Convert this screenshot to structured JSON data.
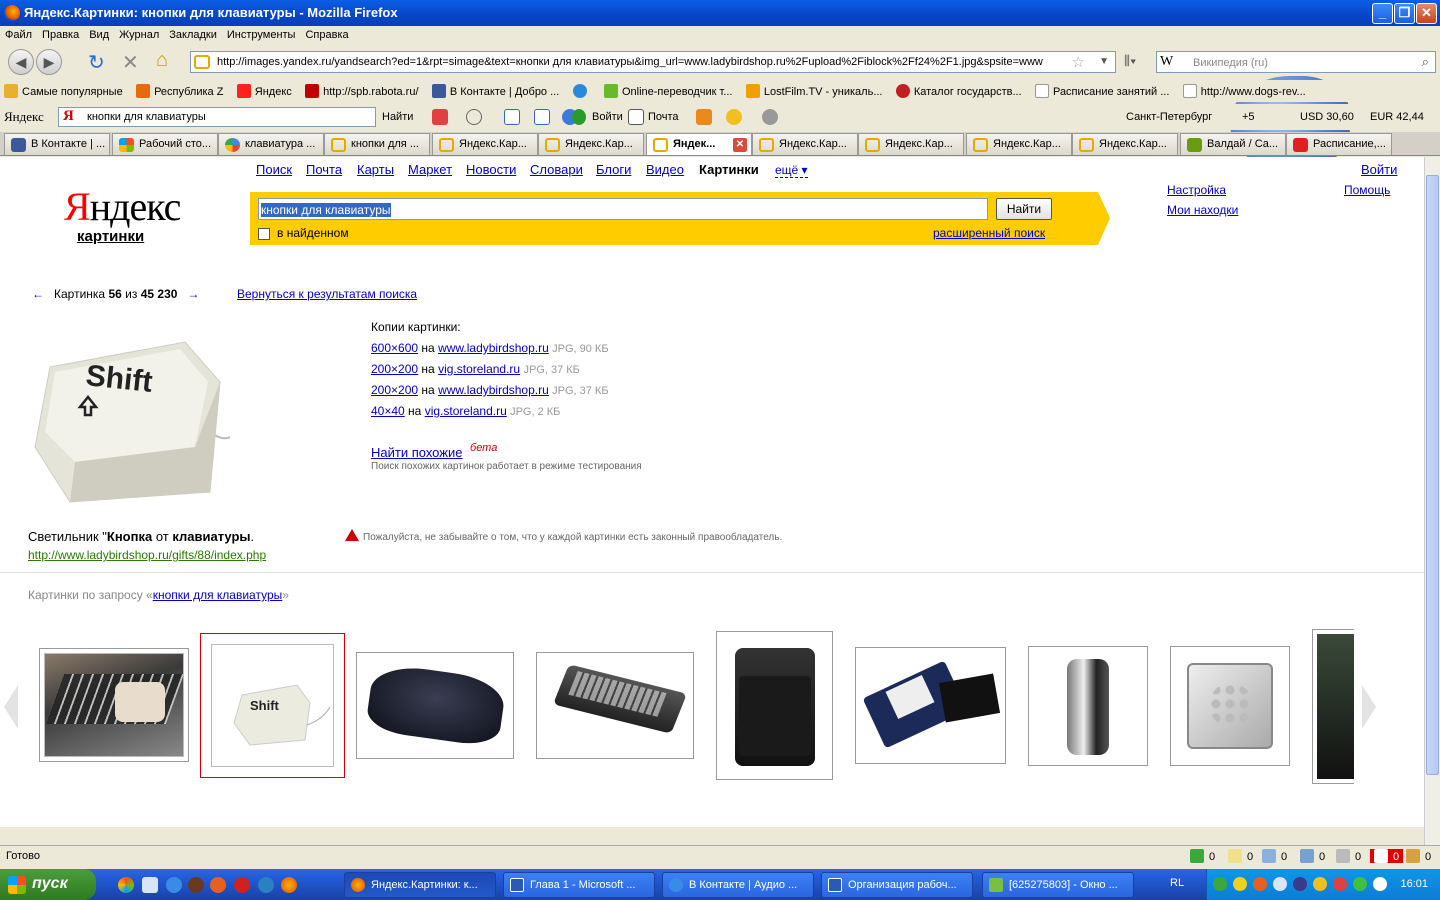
{
  "window": {
    "title": "Яндекс.Картинки: кнопки для клавиатуры - Mozilla Firefox"
  },
  "menu": [
    "Файл",
    "Правка",
    "Вид",
    "Журнал",
    "Закладки",
    "Инструменты",
    "Справка"
  ],
  "nav": {
    "url": "http://images.yandex.ru/yandsearch?ed=1&rpt=simage&text=кнопки для клавиатуры&img_url=www.ladybirdshop.ru%2Fupload%2Fiblock%2Ff24%2F1.jpg&spsite=www",
    "wiki_placeholder": "Википедия (ru)",
    "wiki_icon_letter": "W"
  },
  "bookmarks": [
    {
      "label": "Самые популярные",
      "color": "#e8b030"
    },
    {
      "label": "Республика Z",
      "color": "#e86a10"
    },
    {
      "label": "Яндекс",
      "color": "#ff2020"
    },
    {
      "label": "http://spb.rabota.ru/",
      "color": "#c00000"
    },
    {
      "label": "В Контакте | Добро ...",
      "color": "#3b5998"
    },
    {
      "label": "",
      "color": "#2a8ad8"
    },
    {
      "label": "Online-переводчик т...",
      "color": "#6ab82c"
    },
    {
      "label": "LostFilm.TV - уникаль...",
      "color": "#f0a000"
    },
    {
      "label": "Каталог государств...",
      "color": "#c02020"
    },
    {
      "label": "Расписание занятий ...",
      "color": "#ffffff"
    },
    {
      "label": "http://www.dogs-rev...",
      "color": "#ffffff"
    }
  ],
  "yandex_bar": {
    "logo": "Яндекс",
    "query": "кнопки для клавиатуры",
    "find": "Найти",
    "login": "Войти",
    "mail": "Почта",
    "city": "Санкт-Петербург",
    "temp": "+5",
    "usd": "USD 30,60",
    "eur": "EUR 42,44"
  },
  "tabs": [
    {
      "label": "В Контакте | ...",
      "active": false
    },
    {
      "label": "Рабочий сто...",
      "active": false
    },
    {
      "label": "клавиатура ...",
      "active": false
    },
    {
      "label": "кнопки для ...",
      "active": false
    },
    {
      "label": "Яндекс.Кар...",
      "active": false
    },
    {
      "label": "Яндекс.Кар...",
      "active": false
    },
    {
      "label": "Яндек...",
      "active": true
    },
    {
      "label": "Яндекс.Кар...",
      "active": false
    },
    {
      "label": "Яндекс.Кар...",
      "active": false
    },
    {
      "label": "Яндекс.Кар...",
      "active": false
    },
    {
      "label": "Яндекс.Кар...",
      "active": false
    },
    {
      "label": "Валдай / Са...",
      "active": false
    },
    {
      "label": "Расписание,...",
      "active": false
    }
  ],
  "page": {
    "logo_first": "Я",
    "logo_rest": "ндекс",
    "logo_sub": "картинки",
    "services": [
      "Поиск",
      "Почта",
      "Карты",
      "Маркет",
      "Новости",
      "Словари",
      "Блоги",
      "Видео"
    ],
    "current_service": "Картинки",
    "more": "ещё ▾",
    "search_value": "кнопки для клавиатуры",
    "search_button": "Найти",
    "in_found": "в найденном",
    "advanced": "расширенный поиск",
    "settings": "Настройка",
    "my_finds": "Мои находки",
    "login": "Войти",
    "help": "Помощь",
    "pager_prefix": "Картинка",
    "pager_current": "56",
    "pager_of": "из",
    "pager_total": "45 230",
    "back": "Вернуться к результатам поиска",
    "copies_heading": "Копии картинки:",
    "copies": [
      {
        "size": "600×600",
        "on": "на",
        "site": "www.ladybirdshop.ru",
        "meta": "JPG, 90 КБ"
      },
      {
        "size": "200×200",
        "on": "на",
        "site": "vig.storeland.ru",
        "meta": "JPG, 37 КБ"
      },
      {
        "size": "200×200",
        "on": "на",
        "site": "www.ladybirdshop.ru",
        "meta": "JPG, 37 КБ"
      },
      {
        "size": "40×40",
        "on": "на",
        "site": "vig.storeland.ru",
        "meta": "JPG, 2 КБ"
      }
    ],
    "find_similar": "Найти похожие",
    "beta": "бета",
    "similar_note": "Поиск похожих картинок работает в режиме тестирования",
    "caption_a": "Светильник \"",
    "caption_b": "Кнопка",
    "caption_c": " от ",
    "caption_d": "клавиатуры",
    "caption_e": ".",
    "source_url": "http://www.ladybirdshop.ru/gifts/88/index.php",
    "warning": "Пожалуйста, не забывайте о том, что у каждой картинки есть законный правообладатель.",
    "related_prefix": "Картинки по запросу «",
    "related_query": "кнопки для клавиатуры",
    "related_suffix": "»",
    "key_label": "Shift"
  },
  "status": {
    "text": "Готово",
    "counters": [
      "0",
      "0",
      "0",
      "0",
      "0",
      "0",
      "0"
    ]
  },
  "taskbar": {
    "start": "пуск",
    "tasks": [
      {
        "label": "Яндекс.Картинки: к...",
        "active": true
      },
      {
        "label": "Глава 1 - Microsoft ...",
        "active": false
      },
      {
        "label": "В Контакте | Аудио ...",
        "active": false
      },
      {
        "label": "Организация рабоч...",
        "active": false
      },
      {
        "label": "[625275803] - Окно ...",
        "active": false
      }
    ],
    "lang": "RL",
    "clock": "16:01"
  }
}
